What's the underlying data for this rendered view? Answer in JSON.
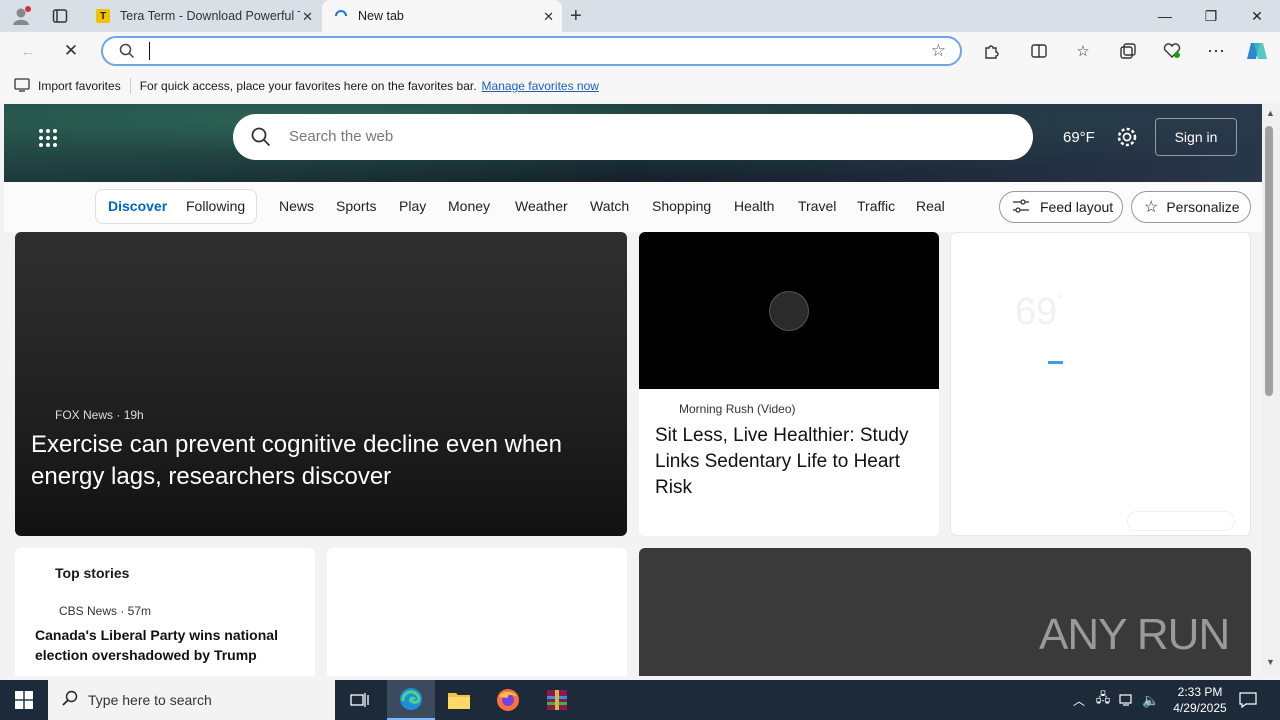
{
  "browser": {
    "tabs": [
      {
        "title": "Tera Term - Download Powerful T",
        "favicon": "T"
      },
      {
        "title": "New tab"
      }
    ],
    "address": "",
    "favorites_bar": {
      "import_label": "Import favorites",
      "hint": "For quick access, place your favorites here on the favorites bar.",
      "manage_link": "Manage favorites now"
    }
  },
  "page": {
    "search_placeholder": "Search the web",
    "temperature": "69°F",
    "sign_in": "Sign in",
    "nav": {
      "pills": [
        "Discover",
        "Following"
      ],
      "items": [
        "News",
        "Sports",
        "Play",
        "Money",
        "Weather",
        "Watch",
        "Shopping",
        "Health",
        "Travel",
        "Traffic",
        "Real E"
      ],
      "feed_layout": "Feed layout",
      "personalize": "Personalize"
    },
    "cards": {
      "hero": {
        "source": "FOX News",
        "age": "19h",
        "headline": "Exercise can prevent cognitive decline even when energy lags, researchers discover"
      },
      "video": {
        "source": "Morning Rush (Video)",
        "headline": "Sit Less, Live Healthier: Study Links Sedentary Life to Heart Risk"
      },
      "weather_widget": {
        "temp": "69",
        "unit": "°"
      },
      "top_stories": {
        "title": "Top stories",
        "source": "CBS News · 57m",
        "headline": "Canada's Liberal Party wins national election overshadowed by Trump"
      },
      "watermark": "ANY RUN"
    }
  },
  "taskbar": {
    "search_placeholder": "Type here to search",
    "time": "2:33 PM",
    "date": "4/29/2025"
  },
  "colors": {
    "accent": "#0067c0",
    "taskbar": "#1c2a3a",
    "link": "#1f5fbf"
  }
}
